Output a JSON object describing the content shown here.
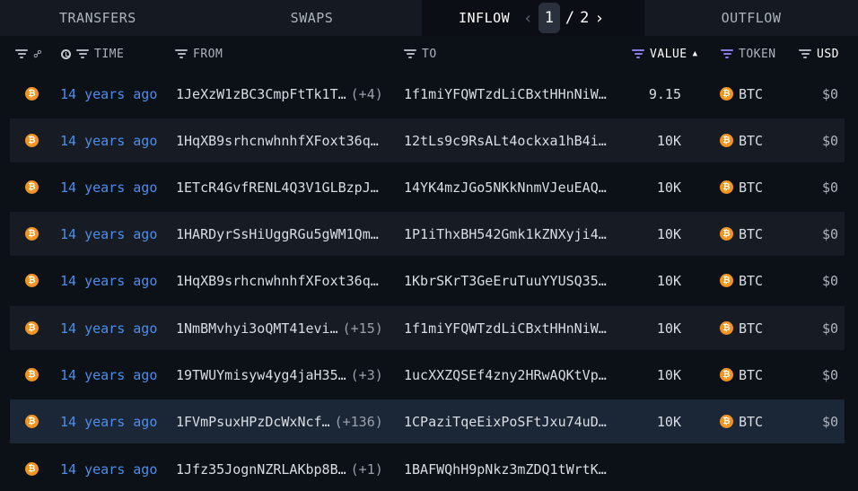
{
  "tabs": [
    {
      "label": "TRANSFERS"
    },
    {
      "label": "SWAPS"
    },
    {
      "label": "INFLOW"
    },
    {
      "label": "OUTFLOW"
    }
  ],
  "pager": {
    "current": "1",
    "separator": "/",
    "total": "2"
  },
  "columns": {
    "time": "TIME",
    "from": "FROM",
    "to": "TO",
    "value": "VALUE",
    "token": "TOKEN",
    "usd": "USD"
  },
  "colors": {
    "accent": "#4d8ee8",
    "bitcoin": "#f29423",
    "active_filter": "#8b7be6",
    "selected_row": "#1b2637"
  },
  "rows": [
    {
      "time": "14 years ago",
      "from": "1JeXzW1zBC3CmpFtTk1T…",
      "from_more": "(+4)",
      "to": "1f1miYFQWTzdLiCBxtHHnNiW…",
      "value": "9.15",
      "token": "BTC",
      "usd": "$0"
    },
    {
      "time": "14 years ago",
      "from": "1HqXB9srhcnwhnhfXFoxt36q…",
      "from_more": "",
      "to": "12tLs9c9RsALt4ockxa1hB4i…",
      "value": "10K",
      "token": "BTC",
      "usd": "$0"
    },
    {
      "time": "14 years ago",
      "from": "1ETcR4GvfRENL4Q3V1GLBzpJ…",
      "from_more": "",
      "to": "14YK4mzJGo5NKkNnmVJeuEAQ…",
      "value": "10K",
      "token": "BTC",
      "usd": "$0"
    },
    {
      "time": "14 years ago",
      "from": "1HARDyrSsHiUggRGu5gWM1Qm…",
      "from_more": "",
      "to": "1P1iThxBH542Gmk1kZNXyji4…",
      "value": "10K",
      "token": "BTC",
      "usd": "$0"
    },
    {
      "time": "14 years ago",
      "from": "1HqXB9srhcnwhnhfXFoxt36q…",
      "from_more": "",
      "to": "1KbrSKrT3GeEruTuuYYUSQ35…",
      "value": "10K",
      "token": "BTC",
      "usd": "$0"
    },
    {
      "time": "14 years ago",
      "from": "1NmBMvhyi3oQMT41evi…",
      "from_more": "(+15)",
      "to": "1f1miYFQWTzdLiCBxtHHnNiW…",
      "value": "10K",
      "token": "BTC",
      "usd": "$0"
    },
    {
      "time": "14 years ago",
      "from": "19TWUYmisyw4yg4jaH35…",
      "from_more": "(+3)",
      "to": "1ucXXZQSEf4zny2HRwAQKtVp…",
      "value": "10K",
      "token": "BTC",
      "usd": "$0"
    },
    {
      "time": "14 years ago",
      "from": "1FVmPsuxHPzDcWxNcf…",
      "from_more": "(+136)",
      "to": "1CPaziTqeEixPoSFtJxu74uD…",
      "value": "10K",
      "token": "BTC",
      "usd": "$0"
    },
    {
      "time": "14 years ago",
      "from": "1Jfz35JognNZRLAKbp8B…",
      "from_more": "(+1)",
      "to": "1BAFWQhH9pNkz3mZDQ1tWrtK…",
      "value": "",
      "token": "",
      "usd": ""
    }
  ]
}
